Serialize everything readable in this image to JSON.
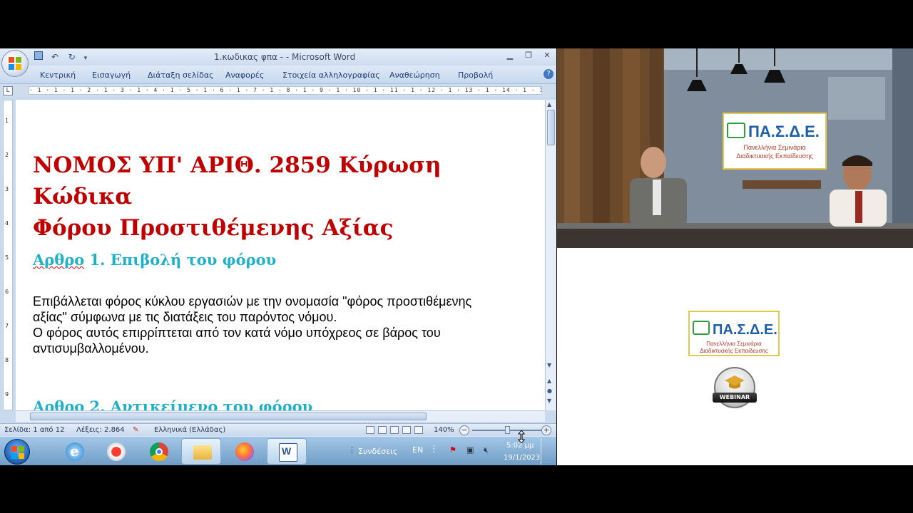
{
  "word": {
    "window_title": "1.κωδικας φπα - - Microsoft Word",
    "ribbon_tabs": [
      "Κεντρική",
      "Εισαγωγή",
      "Διάταξη σελίδας",
      "Αναφορές",
      "Στοιχεία αλληλογραφίας",
      "Αναθεώρηση",
      "Προβολή"
    ],
    "ruler_text": "· 1 · 1 · 1 · 2 · 1 · 3 · 1 · 4 · 1 · 5 · 1 · 6 · 1 · 7 · 1 · 8 · 1 · 9 · 1 · 10 · 1 · 11 · 1 · 12 · 1 · 13 · 1 · 14 · 1 · 15 · 1 · 16 · 1 · 17 · 1 · 18 · 1 · 19 · 1",
    "vruler_marks": [
      "1",
      "2",
      "3",
      "4",
      "5",
      "6",
      "7",
      "8",
      "9"
    ],
    "document": {
      "title_line1": "ΝΟΜΟΣ ΥΠ' ΑΡΙΘ. 2859 Κύρωση Κώδικα",
      "title_line2": "Φόρου Προστιθέμενης Αξίας",
      "article1_word": "Αρθρο",
      "article1_rest": " 1. Επιβολή του φόρου",
      "body_line1": "Επιβάλλεται φόρος κύκλου εργασιών με την ονομασία \"φόρος προστιθέμενης",
      "body_line2": "αξίας\" σύμφωνα με τις διατάξεις του παρόντος νόμου.",
      "body_line3": "Ο φόρος αυτός επιρρίπτεται από τον κατά νόμο υπόχρεος σε βάρος του",
      "body_line4": "αντισυμβαλλομένου.",
      "article2": "Αρθρο 2. Αντικείμενο του φόρου"
    },
    "status": {
      "page": "Σελίδα: 1 από 12",
      "words": "Λέξεις: 2.864",
      "language": "Ελληνικά (Ελλάδας)",
      "zoom": "140%"
    }
  },
  "taskbar": {
    "links_label": "Συνδέσεις",
    "lang": "EN",
    "time": "5:02 μμ",
    "date": "19/1/2023"
  },
  "branding": {
    "logo_title": "ΠΑ.Σ.Δ.Ε.",
    "logo_line1": "Πανελλήνια Σεμινάρια",
    "logo_line2": "Διαδικτυακής Εκπαίδευσης",
    "webinar_label": "WEBINAR"
  },
  "colors": {
    "title_red": "#c00000",
    "heading_cyan": "#1fb1c8",
    "logo_blue": "#1d5fa8"
  }
}
